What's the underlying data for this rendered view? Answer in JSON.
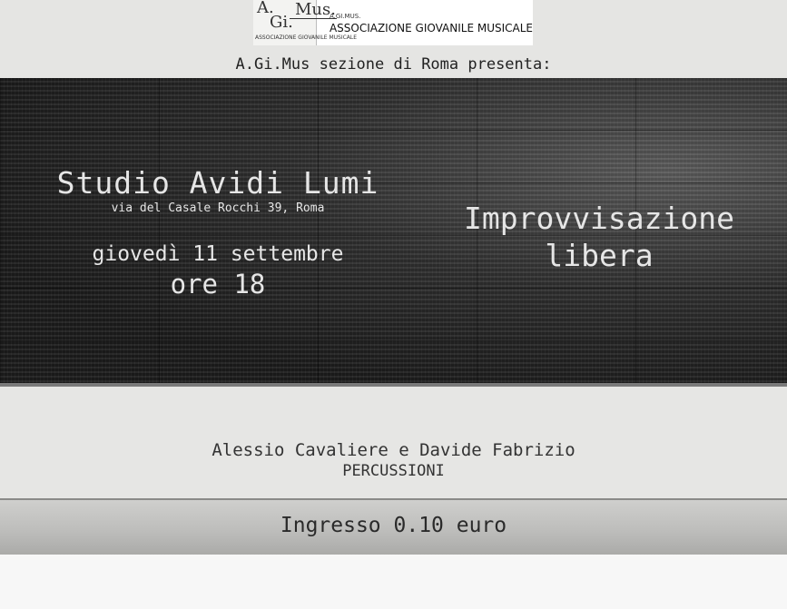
{
  "logo": {
    "mark_a": "A.",
    "mark_gi": "Gi.",
    "mark_mus": "Mus.",
    "mark_sub": "ASSOCIAZIONE GIOVANILE MUSICALE",
    "small": "A.GI.MUS.",
    "name": "ASSOCIAZIONE GIOVANILE MUSICALE"
  },
  "presenter": "A.Gi.Mus sezione di Roma presenta:",
  "event": {
    "venue": "Studio Avidi Lumi",
    "address": "via del Casale Rocchi 39, Roma",
    "date": "giovedì 11 settembre",
    "time": "ore 18",
    "title_line1": "Improvvisazione",
    "title_line2": "libera"
  },
  "performers": "Alessio Cavaliere e Davide Fabrizio",
  "instrument": "PERCUSSIONI",
  "entry": "Ingresso 0.10 euro"
}
